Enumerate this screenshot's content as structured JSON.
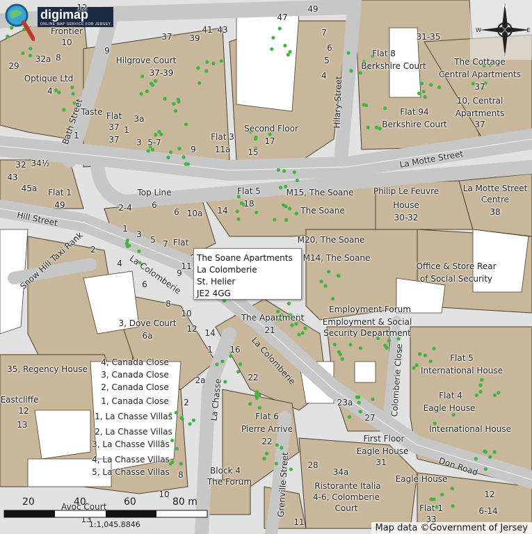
{
  "logo": {
    "name": "digimap",
    "tagline": "ONLINE MAP SERVICE FOR JERSEY"
  },
  "popup": {
    "line1": "The Soane Apartments",
    "line2": "La Colomberie",
    "line3": "St. Helier",
    "line4": "JE2 4GG"
  },
  "streets": {
    "bath": "Bath Street",
    "hilary": "Hilary Street",
    "la_motte": "La Motte Street",
    "hill": "Hill Street",
    "snow_hill": "Snow Hill Taxi Rank",
    "la_colomberie_1": "La Colomberie",
    "la_colomberie_2": "La Colomberie",
    "la_chasse": "La Chasse",
    "grenville": "Grenville Street",
    "colomberie_close": "Colomberie Close",
    "don_road": "Don Road",
    "avoc_court": "Avoc Court"
  },
  "labels": [
    "12",
    "Frontier",
    "10",
    "37",
    "39",
    "41",
    "43",
    "47",
    "49",
    "7",
    "6",
    "5",
    "4",
    "9",
    "Hilgrove Court",
    "37-39",
    "29",
    "32a",
    "8",
    "Optique Ltd",
    "4",
    "Flat 8",
    "Berkshire Court",
    "31-35",
    "The Cottage",
    "Central Apartments",
    "37",
    "10, Central",
    "Apartments",
    "37",
    "Taste",
    "Flat",
    "37",
    "37",
    "1",
    "3a",
    "1",
    "3",
    "5-7",
    "9",
    "Flat 3",
    "11a",
    "Second Floor",
    "17",
    "15",
    "Flat 94",
    "Berkshire Court",
    "32",
    "34½",
    "43",
    "45a",
    "Flat 1",
    "49",
    "Top Line",
    "6",
    "Flat 5",
    "18",
    "M15, The Soane",
    "The Soane",
    "Philip Le Feuvre",
    "House",
    "30-32",
    "La Motte Street",
    "Centre",
    "38",
    "2-4",
    "6",
    "10a",
    "14",
    "1",
    "3",
    "5",
    "7",
    "Flat",
    "9",
    "11",
    "M20, The Soane",
    "M14, The Soane",
    "Office & Store Rear",
    "of Social Security",
    "2",
    "4",
    "6",
    "8",
    "10",
    "12",
    "14",
    "3, Dove Court",
    "6a",
    "1",
    "Employment Forum",
    "Employment & Social",
    "Security Department",
    "The Apartment",
    "21",
    "16",
    "22",
    "35, Regency House",
    "4, Canada Close",
    "3, Canada Close",
    "2, Canada Close",
    "1, Canada Close",
    "2a",
    "2",
    "Eastcliffe",
    "12",
    "13",
    "1, La Chasse Villas",
    "2, La Chasse Villas",
    "3, La Chasse Villas",
    "4, La Chasse Villas",
    "5, La Chasse Villas",
    "8",
    "Flat 6",
    "Pierre Arrive",
    "22",
    "23a",
    "27",
    "Flat 5",
    "International House",
    "Flat 4",
    "Eagle House",
    "International House",
    "First Floor",
    "Eagle House",
    "31",
    "28",
    "34a",
    "Ristorante Italia",
    "4-6, Colomberie",
    "Court",
    "Eagle House",
    "Block 4",
    "The Forum",
    "10",
    "12",
    "6-14",
    "Flat 1",
    "33",
    "11",
    "13"
  ],
  "scale": {
    "ticks": [
      "20",
      "40",
      "60",
      "80 m"
    ],
    "ratio": "1:1,045.8846"
  },
  "attribution": "Map data ©Government of Jersey",
  "compass_letters": {
    "n": "N",
    "s": "S",
    "e": "E",
    "w": "W"
  }
}
